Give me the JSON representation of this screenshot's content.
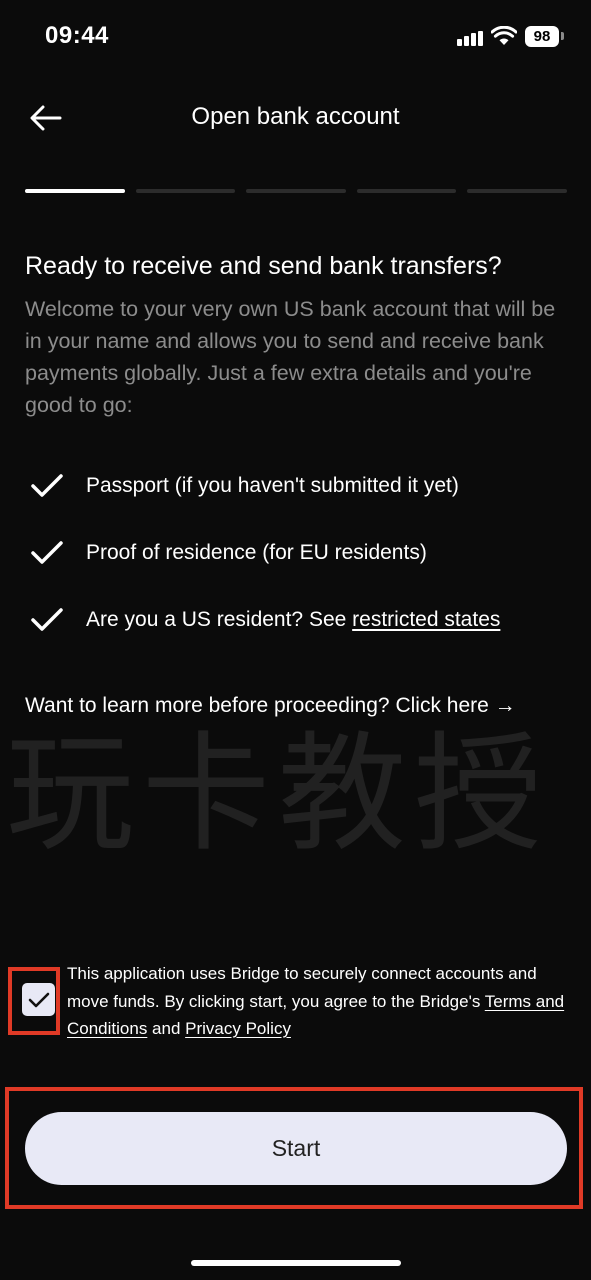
{
  "status_bar": {
    "time": "09:44",
    "battery": "98"
  },
  "header": {
    "title": "Open bank account",
    "back_icon": "arrow-left-icon"
  },
  "progress": {
    "total_steps": 5,
    "current_step": 1
  },
  "content": {
    "heading": "Ready to receive and send bank transfers?",
    "intro": "Welcome to your very own US bank account that will be in your name and allows you to send and receive bank payments globally. Just a few extra details and you're good to go:",
    "requirements": [
      {
        "text": "Passport (if you haven't submitted it yet)"
      },
      {
        "text": "Proof of residence (for EU residents)"
      },
      {
        "text": "Are you a US resident? See ",
        "link": "restricted states"
      }
    ],
    "learn_more": {
      "question": "Want to learn more before proceeding?",
      "link": "Click here →"
    }
  },
  "watermark": "玩卡教授",
  "consent": {
    "checked": true,
    "text_before": "This application uses Bridge to securely connect accounts and move funds. By clicking start, you agree to the Bridge's ",
    "terms_link": "Terms and Conditions",
    "and_text": " and ",
    "privacy_link": "Privacy Policy"
  },
  "start_button": {
    "label": "Start"
  },
  "colors": {
    "background": "#0b0b0b",
    "button": "#e8e9f6",
    "highlight": "#e03a26",
    "muted_text": "#8c8c8c"
  }
}
